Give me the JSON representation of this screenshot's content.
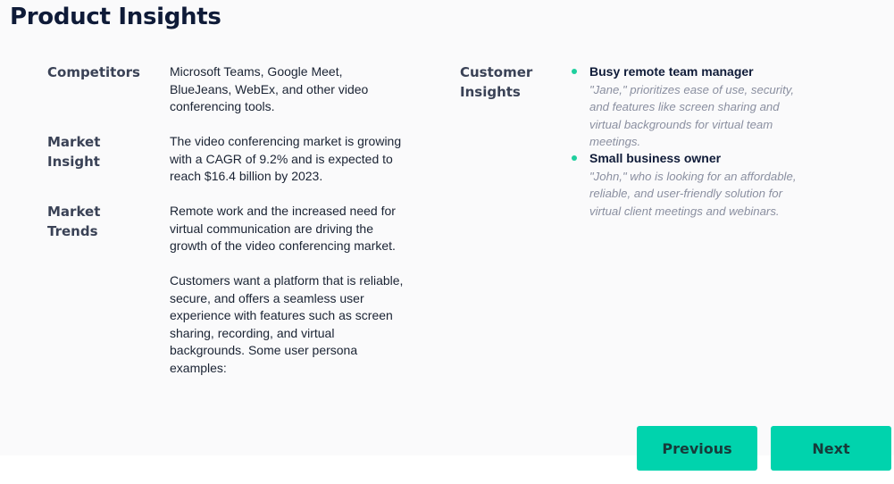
{
  "page_title": "Product Insights",
  "left": {
    "competitors": {
      "label": "Competitors",
      "text": "Microsoft Teams, Google Meet, BlueJeans, WebEx, and other video conferencing tools."
    },
    "market_insight": {
      "label_line1": "Market",
      "label_line2": "Insight",
      "text": "The video conferencing market is growing with a CAGR of 9.2% and is expected to reach $16.4 billion by 2023."
    },
    "market_trends": {
      "label_line1": "Market",
      "label_line2": "Trends",
      "text_p1": "Remote work and the increased need for virtual communication are driving the growth of the video conferencing market.",
      "text_p2": "Customers want a platform that is reliable, secure, and offers a seamless user experience with features such as screen sharing, recording, and virtual backgrounds. Some user persona examples:"
    }
  },
  "customer_insights": {
    "label_line1": "Customer",
    "label_line2": "Insights",
    "personas": [
      {
        "name": "Busy remote team manager",
        "description": "\"Jane,\" prioritizes ease of use, security, and features like screen sharing and virtual backgrounds for virtual team meetings."
      },
      {
        "name": "Small business owner",
        "description": "\"John,\" who is looking for an affordable, reliable, and user-friendly solution for virtual client meetings and webinars."
      }
    ]
  },
  "navigation": {
    "previous_label": "Previous",
    "next_label": "Next"
  },
  "colors": {
    "accent": "#00d3ad",
    "title": "#0f1b38",
    "label": "#3a4256",
    "muted": "#8a8fa0"
  }
}
